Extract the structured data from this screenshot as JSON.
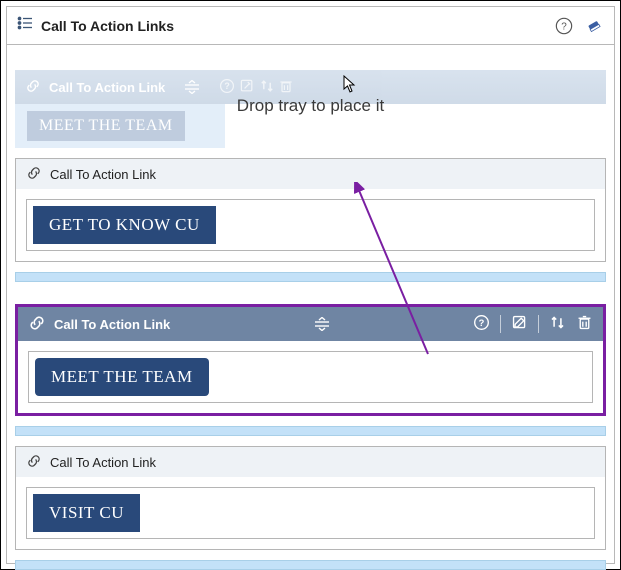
{
  "header": {
    "title": "Call To Action Links"
  },
  "dropzone": {
    "ghost_label": "Call To Action Link",
    "ghost_button": "MEET THE TEAM",
    "drop_text": "Drop tray to place it"
  },
  "cards": [
    {
      "label": "Call To Action Link",
      "button": "GET TO KNOW CU"
    },
    {
      "label": "Call To Action Link",
      "button": "MEET THE TEAM"
    },
    {
      "label": "Call To Action Link",
      "button": "VISIT CU"
    }
  ]
}
